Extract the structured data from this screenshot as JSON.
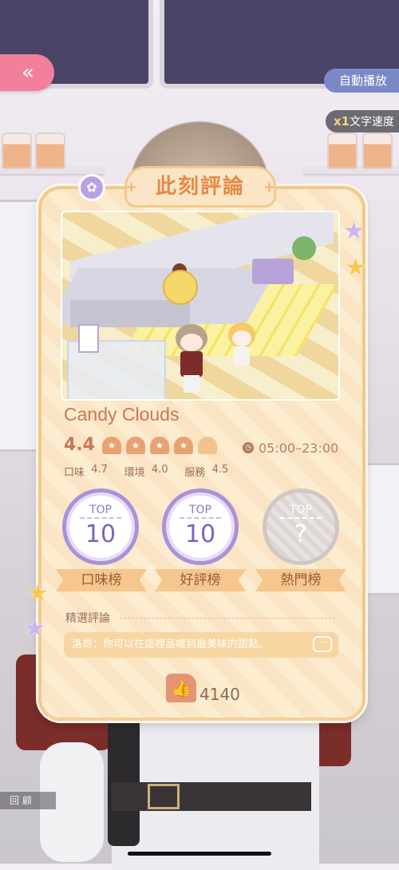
{
  "controls": {
    "back_label": "«",
    "autoplay_label": "自動播放",
    "speed_multiplier": "x1",
    "speed_label": "文字速度",
    "review_label": "回 顧"
  },
  "card": {
    "title": "此刻評論",
    "plus_left": "+",
    "plus_right": "+",
    "shop_name": "Candy Clouds",
    "rating": "4.4",
    "rating_fill": 4.4,
    "rating_max": 5,
    "hours": "05:00–23:00",
    "sub_ratings": [
      {
        "label": "口味",
        "value": "4.7"
      },
      {
        "label": "環境",
        "value": "4.0"
      },
      {
        "label": "服務",
        "value": "4.5"
      }
    ],
    "badges": [
      {
        "top": "TOP",
        "rank": "10",
        "name": "口味榜",
        "state": "active"
      },
      {
        "top": "TOP",
        "rank": "10",
        "name": "好評榜",
        "state": "active"
      },
      {
        "top": "TOP",
        "rank": "?",
        "name": "熱門榜",
        "state": "locked"
      }
    ],
    "featured_label": "精選評論",
    "featured_comment": "洛昂：你可以在這裡品嚐到最美味的甜點。",
    "like_count": "4140"
  },
  "colors": {
    "accent": "#e58a46",
    "badge_purple": "#a992d8",
    "back_pink": "#f27f9c",
    "autoplay_blue": "#7a88c8"
  },
  "icons": {
    "back": "double-chevron-left-icon",
    "flower": "flower-icon",
    "clock": "clock-icon",
    "chat": "chat-bubble-icon",
    "like": "thumbs-up-icon",
    "rating": "bun-icon"
  }
}
